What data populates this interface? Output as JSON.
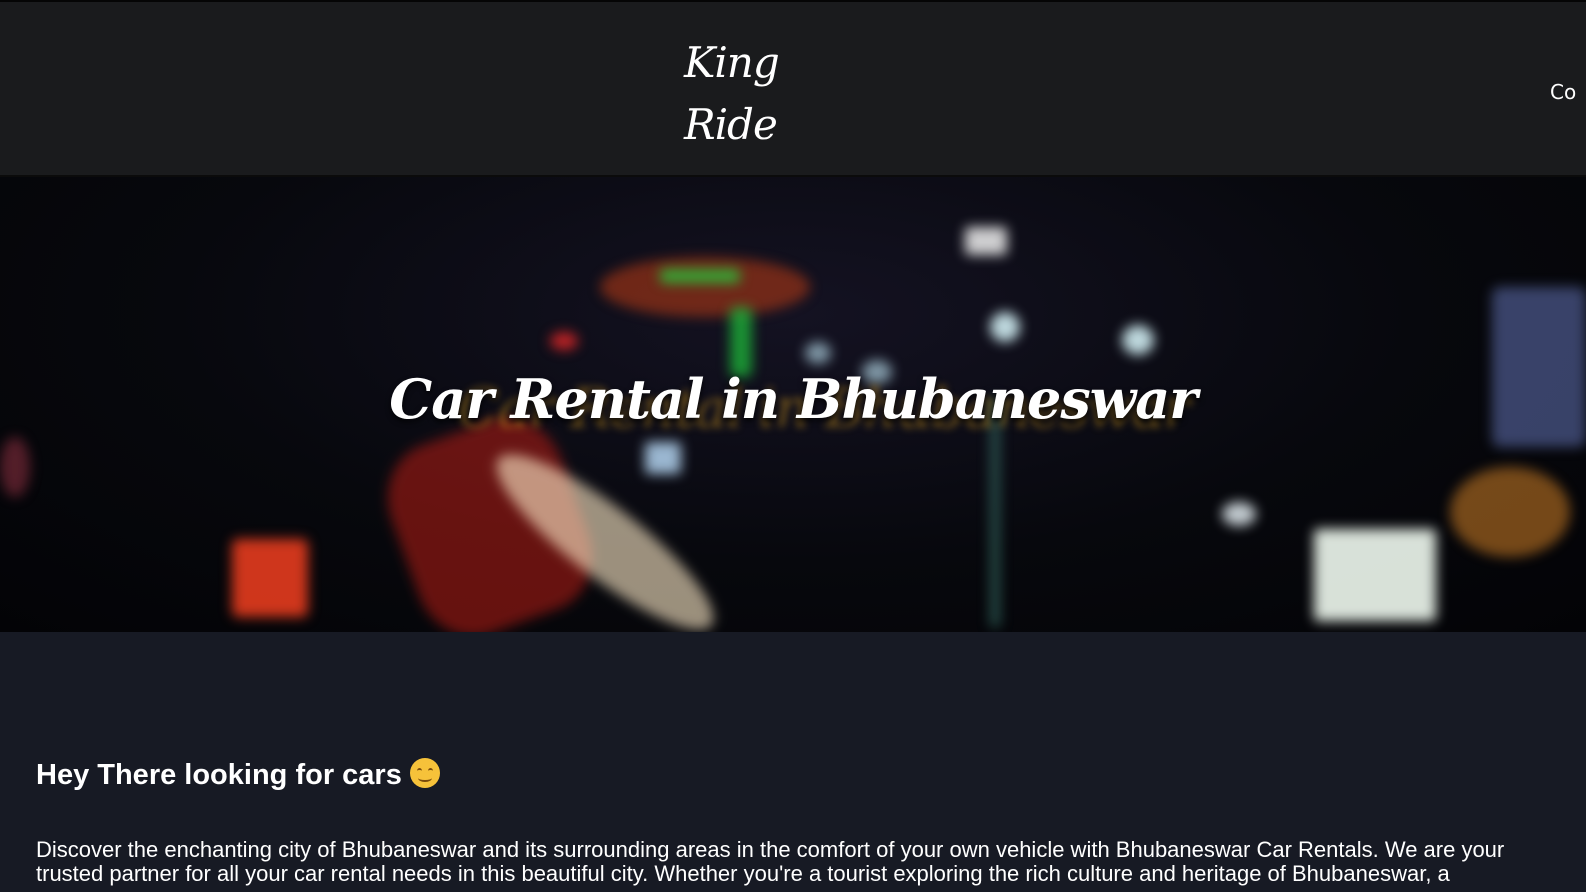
{
  "header": {
    "logo_line1": "King",
    "logo_line2": "Ride",
    "nav_partial": "Co"
  },
  "hero": {
    "title": "Car Rental in Bhubaneswar"
  },
  "main": {
    "greeting": "Hey There looking for cars",
    "greeting_emoji": "smiling-face-icon",
    "intro": "Discover the enchanting city of Bhubaneswar and its surrounding areas in the comfort of your own vehicle with Bhubaneswar Car Rentals. We are your trusted partner for all your car rental needs in this beautiful city. Whether you're a tourist exploring the rich culture and heritage of Bhubaneswar, a"
  },
  "colors": {
    "header_bg": "#1a1b1d",
    "content_bg": "#171a24",
    "text": "#ffffff",
    "emoji": "#f6c23a"
  }
}
